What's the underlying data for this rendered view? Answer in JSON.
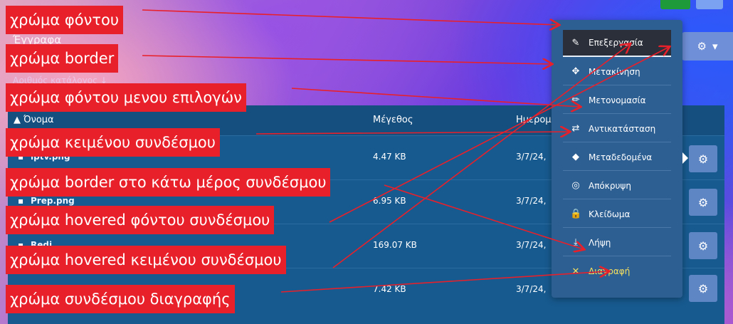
{
  "breadcrumb": "Έγγραφα",
  "sort_hint": "Αριθμός κατάλογος ↓",
  "top_gear": {
    "icon": "gear-icon",
    "chevron": "▾"
  },
  "table": {
    "headers": [
      "Όνομα",
      "Μέγεθος",
      "Ημερομηνία"
    ],
    "rows": [
      {
        "name": "iptv.png",
        "size": "4.47 KB",
        "date": "3/7/24,"
      },
      {
        "name": "Prep.png",
        "size": "6.95 KB",
        "date": "3/7/24,"
      },
      {
        "name": "Redi…",
        "size": "169.07 KB",
        "date": "3/7/24,"
      },
      {
        "name": "",
        "size": "7.42 KB",
        "date": "3/7/24,"
      }
    ]
  },
  "menu": {
    "items": [
      {
        "label": "Επεξεργασία",
        "icon": "edit-icon",
        "glyph": "✎"
      },
      {
        "label": "Μετακίνηση",
        "icon": "move-icon",
        "glyph": "✥"
      },
      {
        "label": "Μετονομασία",
        "icon": "pencil-icon",
        "glyph": "✏"
      },
      {
        "label": "Αντικατάσταση",
        "icon": "replace-icon",
        "glyph": "⇄"
      },
      {
        "label": "Μεταδεδομένα",
        "icon": "tag-icon",
        "glyph": "◆"
      },
      {
        "label": "Απόκρυψη",
        "icon": "eye-slash-icon",
        "glyph": "◎"
      },
      {
        "label": "Κλείδωμα",
        "icon": "lock-icon",
        "glyph": "🔒"
      },
      {
        "label": "Λήψη",
        "icon": "download-icon",
        "glyph": "⤓"
      },
      {
        "label": "Διαγραφή",
        "icon": "close-icon",
        "glyph": "✕"
      }
    ]
  },
  "annotations": [
    "χρώμα φόντου",
    "χρώμα border",
    "χρώμα φόντου μενου επιλογών",
    "χρώμα κειμένου συνδέσμου",
    "χρώμα border στο κάτω μέρος συνδέσμου",
    "χρώμα hovered φόντου συνδέσμου",
    "χρώμα hovered κειμένου συνδέσμου",
    "χρώμα συνδέσμου διαγραφής"
  ],
  "colors": {
    "menu_bg": "#2d5f93",
    "active_bg": "#2a2f3a",
    "delete_text": "#f6e05e",
    "annotation_bg": "#e8202a",
    "table_bg": "#175a8f"
  }
}
